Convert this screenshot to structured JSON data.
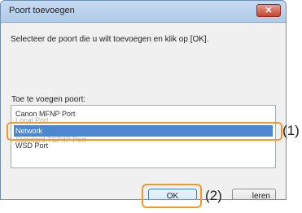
{
  "window": {
    "title": "Poort toevoegen",
    "close_glyph": "✕"
  },
  "instruction": "Selecteer de poort die u wilt toevoegen en klik op [OK].",
  "port_list": {
    "label": "Toe te voegen poort:",
    "items": [
      "Canon MFNP Port",
      "Local Port",
      "Network",
      "Standard TCP/IP Port",
      "WSD Port"
    ],
    "selected": "Network"
  },
  "buttons": {
    "ok": "OK",
    "cancel_visible": "leren"
  },
  "callouts": {
    "one": "(1)",
    "two": "(2)"
  },
  "colors": {
    "highlight": "#f19a2c",
    "selection": "#4d87cf"
  }
}
